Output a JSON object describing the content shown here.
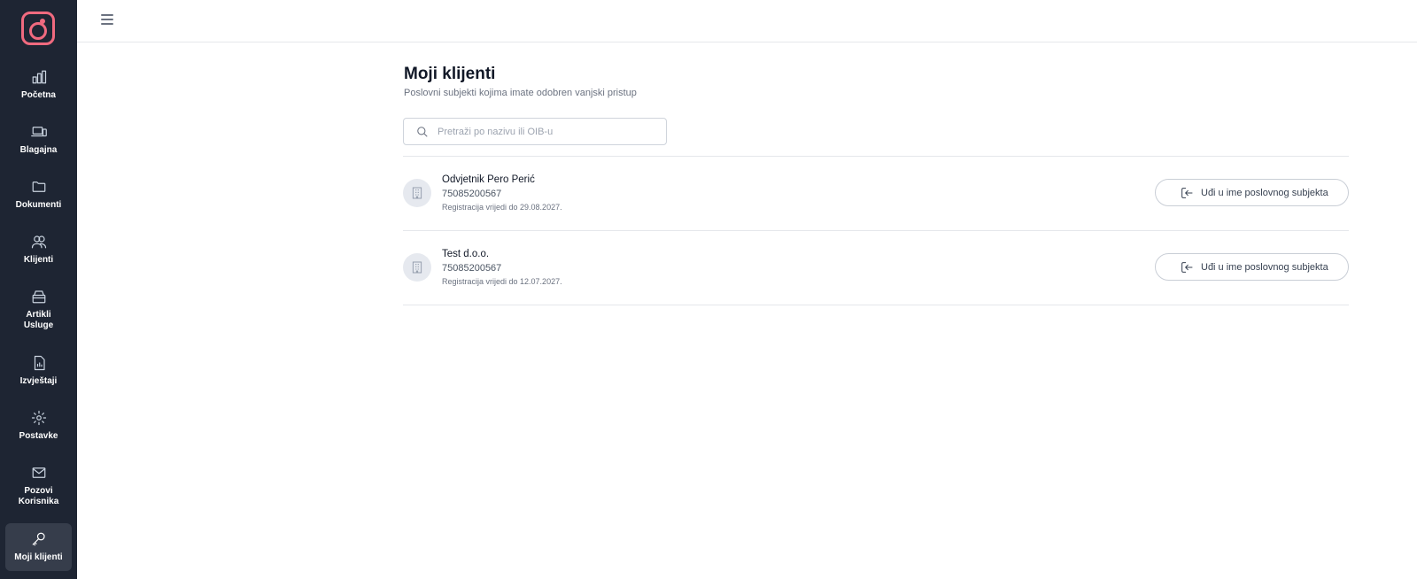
{
  "sidebar": {
    "items": [
      {
        "label": "Početna",
        "icon": "bar-chart-icon"
      },
      {
        "label": "Blagajna",
        "icon": "laptop-phone-icon"
      },
      {
        "label": "Dokumenti",
        "icon": "folder-icon"
      },
      {
        "label": "Klijenti",
        "icon": "users-icon"
      },
      {
        "label": "Artikli\nUsluge",
        "icon": "box-icon"
      },
      {
        "label": "Izvještaji",
        "icon": "report-icon"
      },
      {
        "label": "Postavke",
        "icon": "gear-icon"
      },
      {
        "label": "Pozovi\nKorisnika",
        "icon": "mail-icon"
      },
      {
        "label": "Moji klijenti",
        "icon": "key-icon",
        "active": true
      }
    ]
  },
  "page": {
    "title": "Moji klijenti",
    "subtitle": "Poslovni subjekti kojima imate odobren vanjski pristup"
  },
  "search": {
    "placeholder": "Pretraži po nazivu ili OIB-u",
    "value": ""
  },
  "clients": [
    {
      "name": "Odvjetnik Pero Perić",
      "oib": "75085200567",
      "registration": "Registracija vrijedi do 29.08.2027.",
      "button_label": "Uđi u ime poslovnog subjekta"
    },
    {
      "name": "Test d.o.o.",
      "oib": "75085200567",
      "registration": "Registracija vrijedi do 12.07.2027.",
      "button_label": "Uđi u ime poslovnog subjekta"
    }
  ],
  "colors": {
    "sidebar_bg": "#1e2533",
    "sidebar_active": "#363d4b",
    "brand_accent": "#f06a7f"
  }
}
